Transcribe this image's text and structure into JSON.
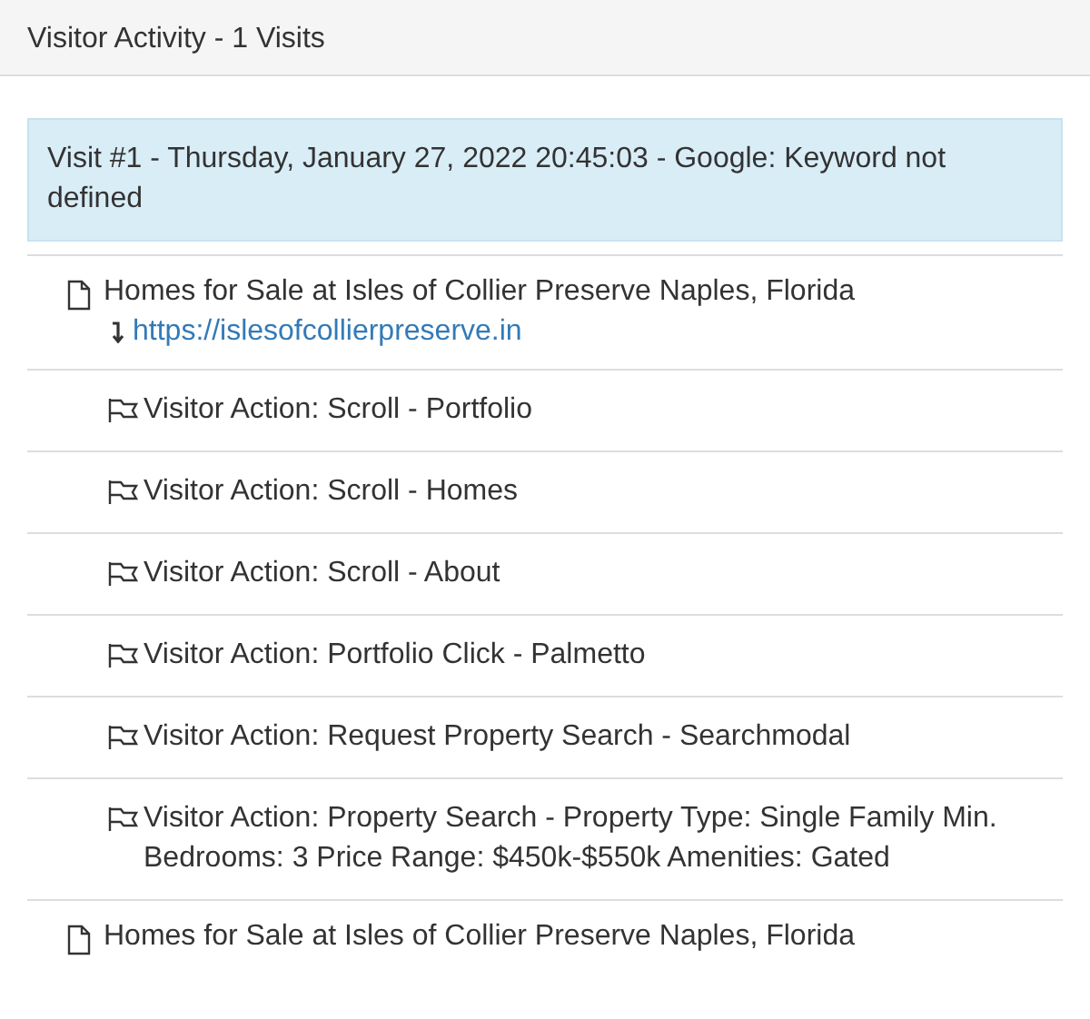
{
  "panel": {
    "title": "Visitor Activity - 1 Visits"
  },
  "visit": {
    "heading": "Visit #1 - Thursday, January 27, 2022 20:45:03 - Google: Keyword not defined"
  },
  "rows": [
    {
      "kind": "page",
      "text": "Homes for Sale at Isles of Collier Preserve Naples, Florida",
      "link": "https://islesofcollierpreserve.in"
    },
    {
      "kind": "action",
      "text": "Visitor Action: Scroll - Portfolio"
    },
    {
      "kind": "action",
      "text": "Visitor Action: Scroll - Homes"
    },
    {
      "kind": "action",
      "text": "Visitor Action: Scroll - About"
    },
    {
      "kind": "action",
      "text": "Visitor Action: Portfolio Click - Palmetto"
    },
    {
      "kind": "action",
      "text": "Visitor Action: Request Property Search - Searchmodal"
    },
    {
      "kind": "action",
      "text": "Visitor Action: Property Search - Property Type: Single Family Min. Bedrooms: 3 Price Range: $450k-$550k Amenities: Gated"
    },
    {
      "kind": "page",
      "text": "Homes for Sale at Isles of Collier Preserve Naples, Florida"
    }
  ]
}
